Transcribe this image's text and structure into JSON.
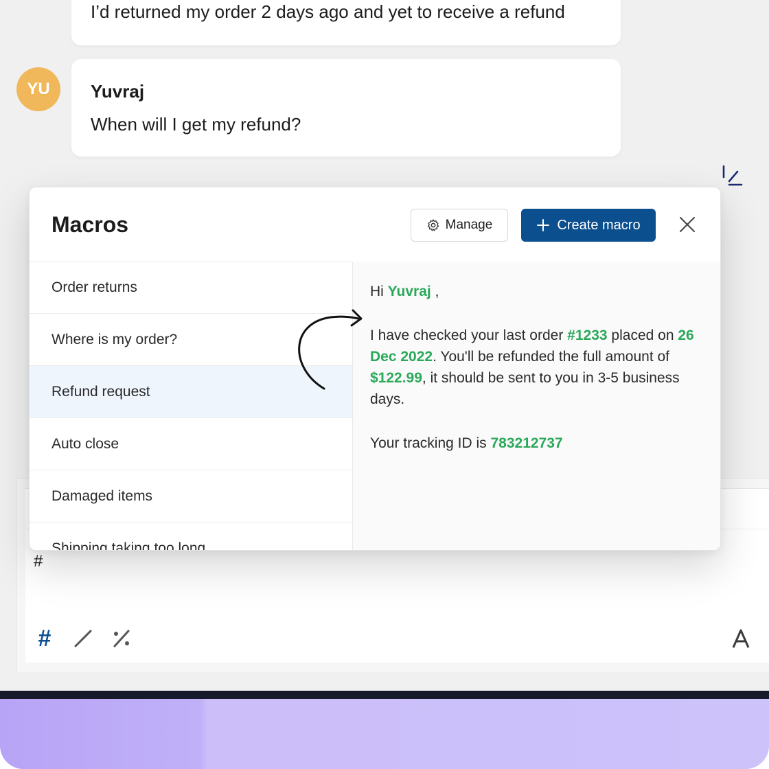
{
  "chat": {
    "previous_message": "I’d returned my order 2 days ago and yet to receive a refund",
    "avatar_initials": "YU",
    "sender_name": "Yuvraj",
    "message": "When will I get my refund?"
  },
  "macros": {
    "title": "Macros",
    "manage_label": "Manage",
    "create_label": "Create macro",
    "items": [
      {
        "label": "Order returns"
      },
      {
        "label": "Where is my order?"
      },
      {
        "label": "Refund request",
        "active": true
      },
      {
        "label": "Auto close"
      },
      {
        "label": "Damaged items"
      },
      {
        "label": "Shipping taking too long"
      }
    ],
    "preview": {
      "greeting": "Hi",
      "customer": "Yuvraj",
      "greeting_end": ",",
      "line1_a": "I have checked your last order",
      "order_id": "#1233",
      "line1_b": "placed on",
      "date": "26 Dec 2022",
      "line1_c": ". You'll be refunded the full amount of",
      "amount": "$122.99",
      "line1_d": ", it should be sent to you in 3-5 business days.",
      "tracking_label": "Your tracking ID is",
      "tracking_id": "783212737"
    }
  },
  "editor": {
    "hash_text": "#"
  },
  "colors": {
    "primary": "#0c4f8f",
    "highlight": "#2aa85a",
    "avatar": "#f0b85a",
    "active_row": "#eef5fd"
  }
}
